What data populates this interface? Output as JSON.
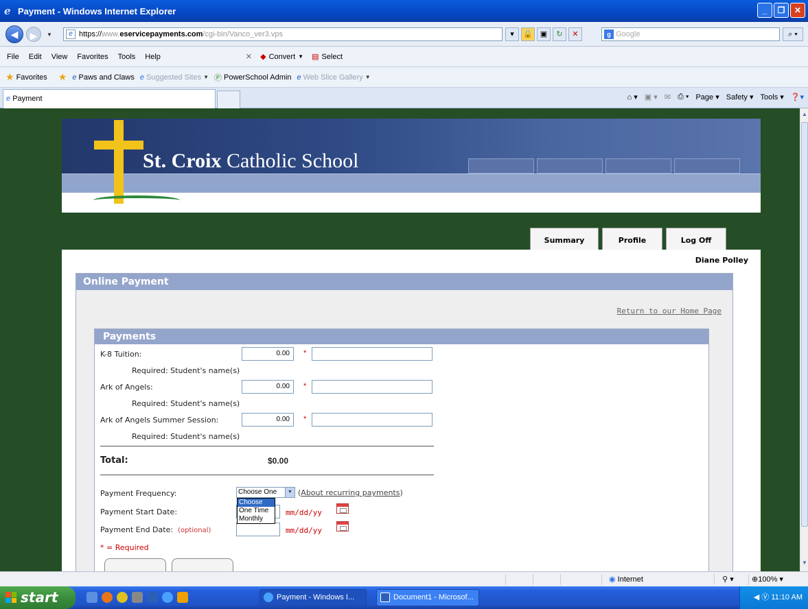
{
  "window": {
    "title": "Payment - Windows Internet Explorer",
    "min": "_",
    "max": "❐",
    "close": "✕"
  },
  "address": {
    "scheme": "https://",
    "host_pre": "www.",
    "host": "eservicepayments.com",
    "path": "/cgi-bin/Vanco_ver3.vps",
    "search_placeholder": "Google"
  },
  "menu": {
    "items": [
      "File",
      "Edit",
      "View",
      "Favorites",
      "Tools",
      "Help"
    ],
    "convert": "Convert",
    "select": "Select"
  },
  "favorites": {
    "label": "Favorites",
    "items": [
      "Paws and Claws",
      "Suggested Sites",
      "PowerSchool Admin",
      "Web Slice Gallery"
    ]
  },
  "tab": {
    "label": "Payment"
  },
  "command_bar": {
    "page": "Page",
    "safety": "Safety",
    "tools": "Tools"
  },
  "site": {
    "name_bold": "St. Croix",
    "name_rest": "Catholic School",
    "nav_tabs": [
      "Summary",
      "Profile",
      "Log Off"
    ],
    "user": "Diane Polley",
    "bg_color": "#254e27"
  },
  "online_payment": {
    "title": "Online Payment",
    "return_link": "Return to our Home Page",
    "payments": {
      "title": "Payments",
      "items": [
        {
          "label": "K-8 Tuition:",
          "amount": "0.00",
          "note": "Required: Student's name(s)"
        },
        {
          "label": "Ark of Angels:",
          "amount": "0.00",
          "note": "Required: Student's name(s)"
        },
        {
          "label": "Ark of Angels Summer Session:",
          "amount": "0.00",
          "note": "Required: Student's name(s)"
        }
      ],
      "required_mark": "*",
      "total_label": "Total:",
      "total_value": "$0.00",
      "frequency_label": "Payment Frequency:",
      "frequency_value": "Choose One",
      "frequency_options": [
        "Choose One",
        "One Time",
        "Monthly"
      ],
      "frequency_help_prefix": "(",
      "frequency_help_link": "About recurring payments",
      "frequency_help_suffix": ")",
      "start_label": "Payment Start Date:",
      "end_label": "Payment End Date:",
      "optional": "(optional)",
      "date_format": "mm/dd/yy",
      "required_note": "* = Required"
    }
  },
  "status": {
    "zone": "Internet",
    "zoom": "100%"
  },
  "taskbar": {
    "start": "start",
    "items": [
      "Payment - Windows I...",
      "Document1 - Microsof..."
    ],
    "clock": "11:10 AM"
  }
}
